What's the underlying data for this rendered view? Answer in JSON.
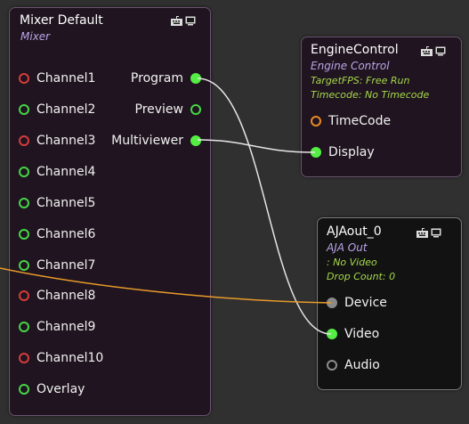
{
  "colors": {
    "background": "#303030",
    "node_bg": "#1f141f",
    "aja_bg": "#121212",
    "subtitle": "#b9a6e8",
    "info": "#a6d84a",
    "wire_white": "#e6e6e6",
    "wire_orange": "#e89a2a"
  },
  "mixer": {
    "title": "Mixer Default",
    "subtitle": "Mixer",
    "inputs": [
      {
        "label": "Channel1",
        "state": "red"
      },
      {
        "label": "Channel2",
        "state": "green-outline"
      },
      {
        "label": "Channel3",
        "state": "red"
      },
      {
        "label": "Channel4",
        "state": "green-outline"
      },
      {
        "label": "Channel5",
        "state": "green-outline"
      },
      {
        "label": "Channel6",
        "state": "green-outline"
      },
      {
        "label": "Channel7",
        "state": "green-outline"
      },
      {
        "label": "Channel8",
        "state": "red"
      },
      {
        "label": "Channel9",
        "state": "green-outline"
      },
      {
        "label": "Channel10",
        "state": "red"
      },
      {
        "label": "Overlay",
        "state": "green-outline"
      }
    ],
    "outputs": [
      {
        "label": "Program",
        "state": "green-fill"
      },
      {
        "label": "Preview",
        "state": "green-outline"
      },
      {
        "label": "Multiviewer",
        "state": "green-fill"
      }
    ]
  },
  "engine": {
    "title": "EngineControl",
    "subtitle": "Engine Control",
    "info": [
      "TargetFPS: Free Run",
      "Timecode: No Timecode"
    ],
    "inputs": [
      {
        "label": "TimeCode",
        "state": "orange"
      },
      {
        "label": "Display",
        "state": "green-fill"
      }
    ]
  },
  "aja": {
    "title": "AJAout_0",
    "subtitle": "AJA Out",
    "info": [
      ": No Video",
      "Drop Count: 0"
    ],
    "inputs": [
      {
        "label": "Device",
        "state": "grey-fill"
      },
      {
        "label": "Video",
        "state": "green-fill"
      },
      {
        "label": "Audio",
        "state": "grey-outline"
      }
    ]
  },
  "header_icons": [
    "keyboard-icon",
    "monitor-icon"
  ]
}
